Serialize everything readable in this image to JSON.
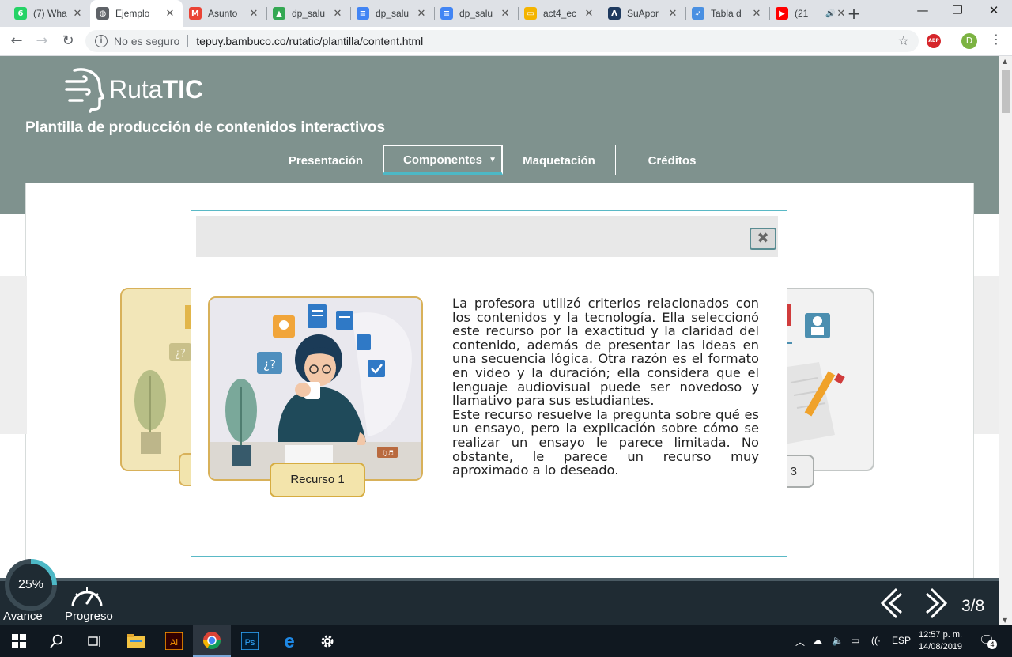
{
  "browser": {
    "tabs": [
      {
        "title": "(7) Wha",
        "favicon": "whatsapp-icon",
        "color": "#25d366",
        "glyph": "6"
      },
      {
        "title": "Ejemplo",
        "favicon": "globe-icon",
        "color": "#5f6368",
        "glyph": "◍",
        "active": true
      },
      {
        "title": "Asunto",
        "favicon": "gmail-icon",
        "color": "#ea4335",
        "glyph": "M"
      },
      {
        "title": "dp_salu",
        "favicon": "drive-icon",
        "color": "#34a853",
        "glyph": "▲"
      },
      {
        "title": "dp_salu",
        "favicon": "docs-icon",
        "color": "#4285f4",
        "glyph": "≡"
      },
      {
        "title": "dp_salu",
        "favicon": "docs-icon",
        "color": "#4285f4",
        "glyph": "≡"
      },
      {
        "title": "act4_ec",
        "favicon": "slides-icon",
        "color": "#f4b400",
        "glyph": "▭"
      },
      {
        "title": "SuApor",
        "favicon": "site-icon",
        "color": "#1f3a5f",
        "glyph": "Λ"
      },
      {
        "title": "Tabla d",
        "favicon": "site-icon",
        "color": "#4a90e2",
        "glyph": "➶"
      },
      {
        "title": "(21",
        "favicon": "youtube-icon",
        "color": "#ff0000",
        "glyph": "▶",
        "audio": true
      }
    ],
    "address": {
      "security_label": "No es seguro",
      "url": "tepuy.bambuco.co/rutatic/plantilla/content.html"
    },
    "abp_label": "ABP",
    "profile_initial": "D"
  },
  "site": {
    "logo_light": "Ruta",
    "logo_bold": "TIC",
    "subtitle": "Plantilla de producción de contenidos interactivos",
    "nav": [
      {
        "label": "Presentación"
      },
      {
        "label": "Componentes",
        "active": true
      },
      {
        "label": "Maquetación"
      },
      {
        "label": "Créditos"
      }
    ]
  },
  "modal": {
    "resource_label": "Recurso 1",
    "paragraph1": "La profesora utilizó criterios relacionados con los contenidos y la tecnología. Ella seleccionó este recurso por la exactitud y la claridad del contenido, además de presentar las ideas en una secuencia lógica. Otra razón es el formato en video y la duración; ella considera que el lenguaje audiovisual puede ser novedoso y llamativo para sus estudiantes.",
    "paragraph2": "Este recurso resuelve la pregunta sobre qué es un ensayo, pero la explicación sobre cómo se realizar un ensayo le parece limitada. No obstante, le parece un recurso muy aproximado a lo deseado.",
    "close_glyph": "✖"
  },
  "background_cards": {
    "right_tag_number": "3",
    "left_card_text": "¿?"
  },
  "footer": {
    "progress_percent": "25%",
    "progress_value": 0.25,
    "avance_label": "Avance",
    "progreso_label": "Progreso",
    "page_counter": "3/8"
  },
  "taskbar": {
    "language": "ESP",
    "time": "12:57 p. m.",
    "date": "14/08/2019",
    "notification_count": "4"
  }
}
